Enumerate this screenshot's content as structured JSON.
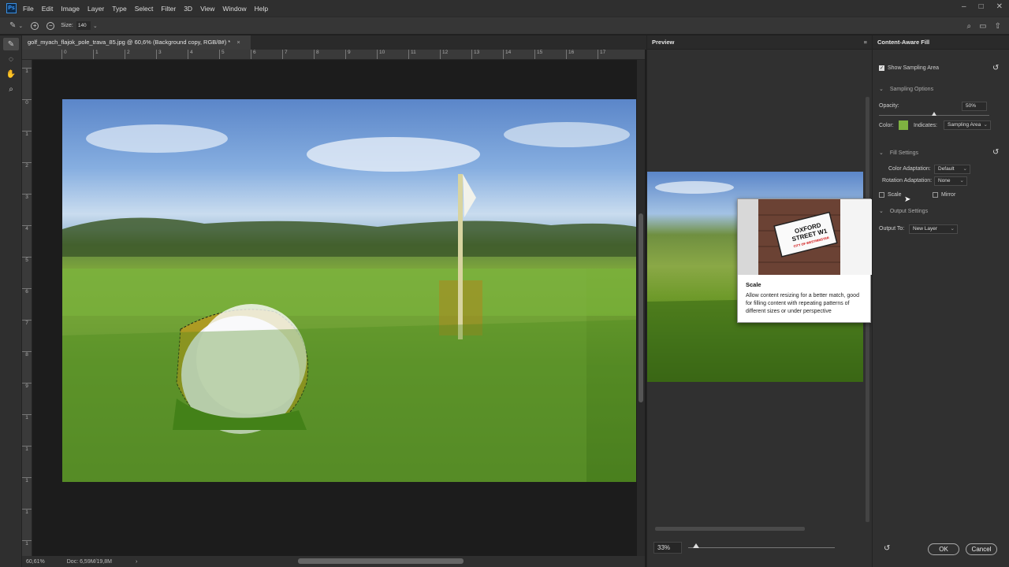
{
  "app": {
    "logo": "Ps",
    "menu": [
      "File",
      "Edit",
      "Image",
      "Layer",
      "Type",
      "Select",
      "Filter",
      "3D",
      "View",
      "Window",
      "Help"
    ],
    "window_controls": [
      "minimize-icon",
      "maximize-icon",
      "close-icon"
    ]
  },
  "options_bar": {
    "size_label": "Size:",
    "size_value": "140"
  },
  "tools": [
    "brush-icon",
    "lasso-icon",
    "hand-icon",
    "zoom-icon"
  ],
  "document": {
    "tab_title": "golf_myach_flajok_pole_trava_85.jpg @ 60,6% (Background copy, RGB/8#) *",
    "tab_close": "×",
    "ruler_top": [
      "0",
      "1",
      "2",
      "3",
      "4",
      "5",
      "6",
      "7",
      "8",
      "9",
      "10",
      "11",
      "12",
      "13",
      "14",
      "15",
      "16",
      "17"
    ],
    "ruler_left": [
      "1",
      "0",
      "1",
      "2",
      "3",
      "4",
      "5",
      "6",
      "7",
      "8",
      "9",
      "1",
      "1",
      "1",
      "1",
      "1"
    ],
    "status_zoom": "60,61%",
    "status_doc": "Doc: 6,59M/19,8M",
    "status_arrow": "›"
  },
  "preview": {
    "title": "Preview",
    "zoom_value": "33%"
  },
  "tooltip": {
    "sign_line1": "OXFORD",
    "sign_line2": "STREET W1",
    "sign_line3": "CITY OF WESTMINSTER",
    "title": "Scale",
    "text": "Allow content resizing for a better match, good for filling content with repeating patterns of different sizes or under perspective"
  },
  "content_aware_fill": {
    "title": "Content-Aware Fill",
    "show_sampling_area": "Show Sampling Area",
    "sampling_options": "Sampling Options",
    "opacity_label": "Opacity:",
    "opacity_value": "50%",
    "color_label": "Color:",
    "overlay_color": "#7fb241",
    "indicates_label": "Indicates:",
    "indicates_value": "Sampling Area",
    "fill_settings": "Fill Settings",
    "color_adaptation_label": "Color Adaptation:",
    "color_adaptation_value": "Default",
    "rotation_adaptation_label": "Rotation Adaptation:",
    "rotation_adaptation_value": "None",
    "scale_label": "Scale",
    "mirror_label": "Mirror",
    "output_settings": "Output Settings",
    "output_to_label": "Output To:",
    "output_to_value": "New Layer",
    "ok_label": "OK",
    "cancel_label": "Cancel"
  }
}
